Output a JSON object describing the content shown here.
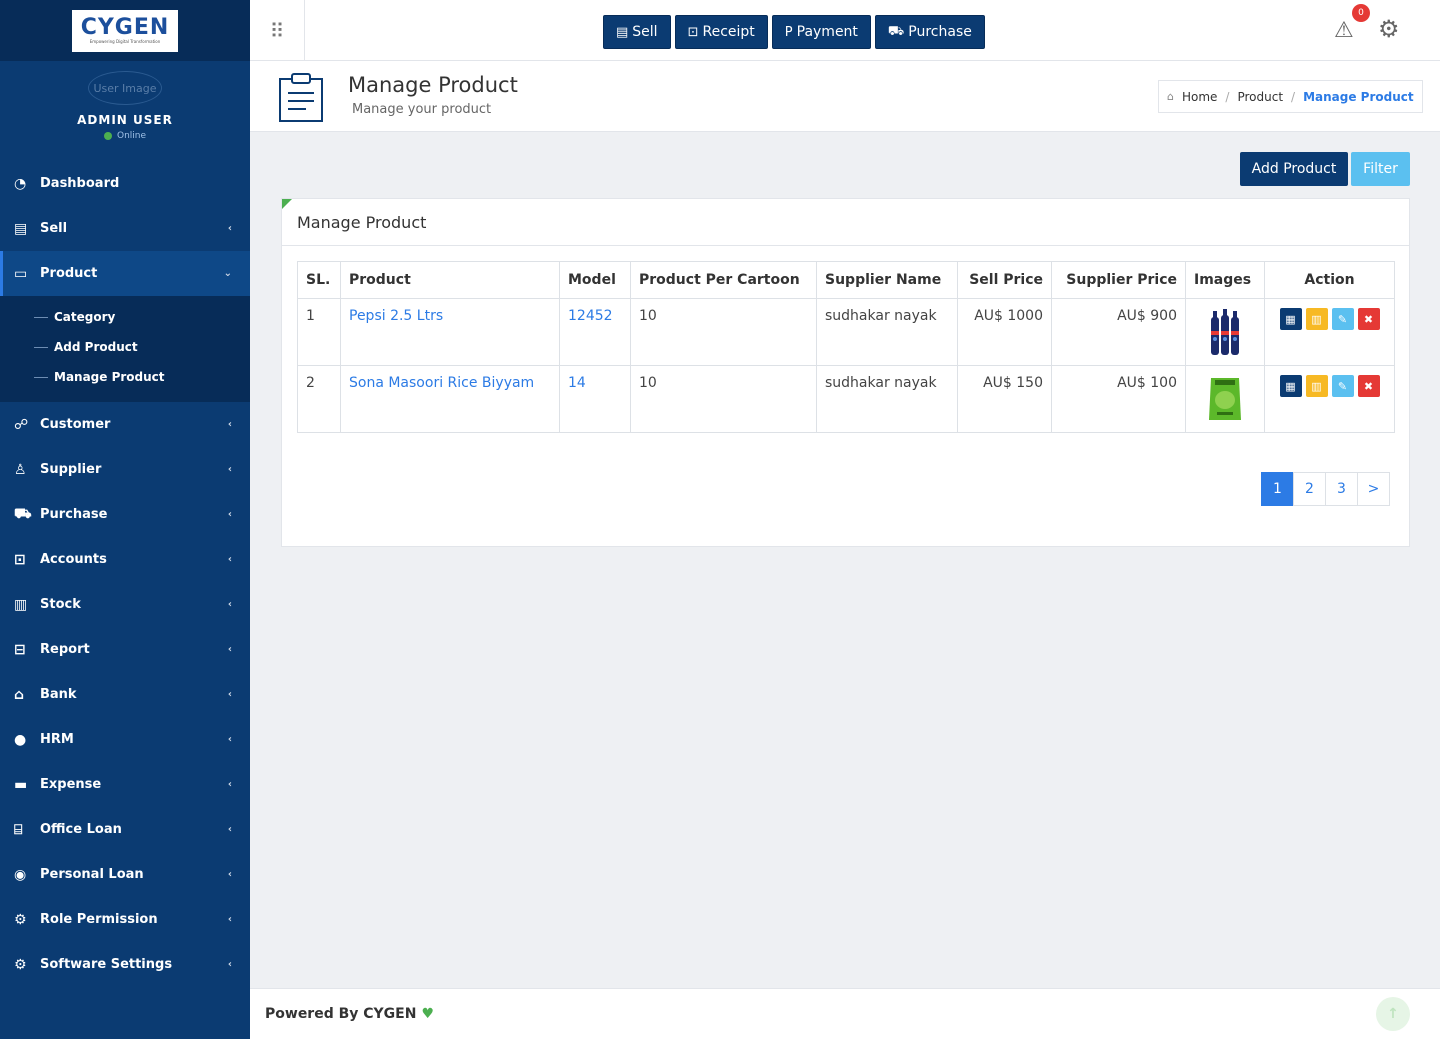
{
  "logo": {
    "text": "CYGEN",
    "tagline": "Empowering Digital Transformation"
  },
  "user": {
    "image_alt": "User Image",
    "name": "ADMIN USER",
    "status": "Online"
  },
  "sidebar": {
    "items": [
      {
        "label": "Dashboard",
        "icon": "dashboard-icon"
      },
      {
        "label": "Sell",
        "icon": "sell-icon"
      },
      {
        "label": "Product",
        "icon": "product-icon"
      },
      {
        "label": "Customer",
        "icon": "customer-icon"
      },
      {
        "label": "Supplier",
        "icon": "supplier-icon"
      },
      {
        "label": "Purchase",
        "icon": "cart-icon"
      },
      {
        "label": "Accounts",
        "icon": "money-icon"
      },
      {
        "label": "Stock",
        "icon": "bar-chart-icon"
      },
      {
        "label": "Report",
        "icon": "book-icon"
      },
      {
        "label": "Bank",
        "icon": "bank-icon"
      },
      {
        "label": "HRM",
        "icon": "person-icon"
      },
      {
        "label": "Expense",
        "icon": "card-icon"
      },
      {
        "label": "Office Loan",
        "icon": "institution-icon"
      },
      {
        "label": "Personal Loan",
        "icon": "user-circle-icon"
      },
      {
        "label": "Role Permission",
        "icon": "gear-icon"
      },
      {
        "label": "Software Settings",
        "icon": "gear-icon"
      }
    ],
    "product_submenu": [
      "Category",
      "Add Product",
      "Manage Product"
    ]
  },
  "topbar": {
    "buttons": [
      {
        "label": "Sell",
        "icon": "register-icon"
      },
      {
        "label": "Receipt",
        "icon": "money-icon"
      },
      {
        "label": "Payment",
        "icon": "paypal-icon"
      },
      {
        "label": "Purchase",
        "icon": "cart-icon"
      }
    ],
    "alert_count": "0"
  },
  "page": {
    "title": "Manage Product",
    "subtitle": "Manage your product",
    "breadcrumb": [
      "Home",
      "Product",
      "Manage Product"
    ]
  },
  "actions": {
    "add_product": "Add Product",
    "filter": "Filter"
  },
  "panel": {
    "title": "Manage Product"
  },
  "table": {
    "headers": [
      "SL.",
      "Product",
      "Model",
      "Product Per Cartoon",
      "Supplier Name",
      "Sell Price",
      "Supplier Price",
      "Images",
      "Action"
    ],
    "rows": [
      {
        "sl": "1",
        "product": "Pepsi 2.5 Ltrs",
        "model": "12452",
        "per_cartoon": "10",
        "supplier": "sudhakar nayak",
        "sell_price": "AU$ 1000",
        "supplier_price": "AU$ 900",
        "image": "pepsi-bottles-image"
      },
      {
        "sl": "2",
        "product": "Sona Masoori Rice Biyyam",
        "model": "14",
        "per_cartoon": "10",
        "supplier": "sudhakar nayak",
        "sell_price": "AU$ 150",
        "supplier_price": "AU$ 100",
        "image": "rice-bag-image"
      }
    ]
  },
  "pagination": {
    "pages": [
      "1",
      "2",
      "3"
    ],
    "next": ">",
    "current": "1"
  },
  "footer": {
    "text": "Powered By CYGEN"
  },
  "colors": {
    "sidebar": "#0b3b72",
    "primary": "#0b3b72",
    "info": "#5bc0f0",
    "link": "#2c7be5",
    "accent_green": "#4caf50"
  }
}
